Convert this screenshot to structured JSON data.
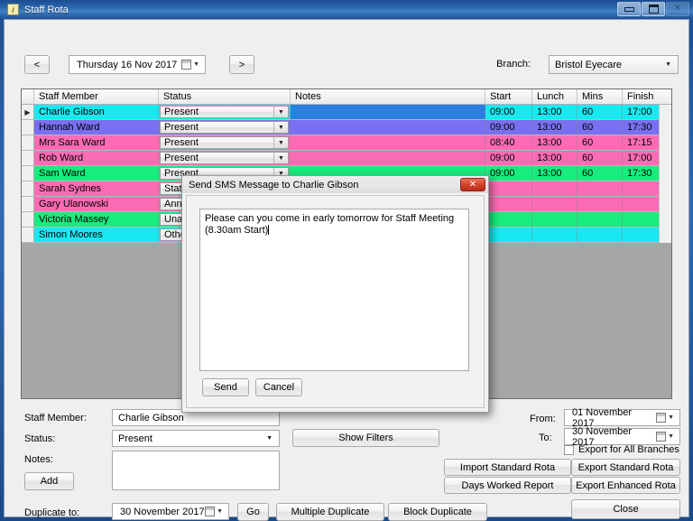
{
  "window": {
    "title": "Staff Rota",
    "icon": "info-icon",
    "minimize": "minimize-icon",
    "maximize": "maximize-icon",
    "close": "close-icon"
  },
  "toolbar": {
    "prev_label": "<",
    "next_label": ">",
    "date_value": "Thursday   16 Nov 2017",
    "branch_label": "Branch:",
    "branch_value": "Bristol Eyecare"
  },
  "grid": {
    "columns": [
      "Staff Member",
      "Status",
      "Notes",
      "Start",
      "Lunch",
      "Mins",
      "Finish"
    ],
    "rows": [
      {
        "selected": true,
        "name": "Charlie Gibson",
        "status": "Present",
        "notes": "",
        "start": "09:00",
        "lunch": "13:00",
        "mins": "60",
        "finish": "17:00",
        "color": "#16eaf0",
        "notes_color": "#2a7fe0"
      },
      {
        "selected": false,
        "name": "Hannah Ward",
        "status": "Present",
        "notes": "",
        "start": "09:00",
        "lunch": "13:00",
        "mins": "60",
        "finish": "17:30",
        "color": "#7a6ff0",
        "notes_color": "#7a6ff0"
      },
      {
        "selected": false,
        "name": "Mrs Sara Ward",
        "status": "Present",
        "notes": "",
        "start": "08:40",
        "lunch": "13:00",
        "mins": "60",
        "finish": "17:15",
        "color": "#fc6cb4",
        "notes_color": "#fc6cb4"
      },
      {
        "selected": false,
        "name": "Rob Ward",
        "status": "Present",
        "notes": "",
        "start": "09:00",
        "lunch": "13:00",
        "mins": "60",
        "finish": "17:00",
        "color": "#fc6cb4",
        "notes_color": "#fc6cb4"
      },
      {
        "selected": false,
        "name": "Sam Ward",
        "status": "Present",
        "notes": "",
        "start": "09:00",
        "lunch": "13:00",
        "mins": "60",
        "finish": "17:30",
        "color": "#18ec7e",
        "notes_color": "#18ec7e"
      },
      {
        "selected": false,
        "name": "Sarah Sydnes",
        "status": "Statutory holiday",
        "notes": "",
        "start": "",
        "lunch": "",
        "mins": "",
        "finish": "",
        "color": "#fc6cb4",
        "notes_color": "#fc6cb4"
      },
      {
        "selected": false,
        "name": "Gary Ulanowski",
        "status": "Annual holiday",
        "notes": "",
        "start": "",
        "lunch": "",
        "mins": "",
        "finish": "",
        "color": "#fc6cb4",
        "notes_color": "#fc6cb4"
      },
      {
        "selected": false,
        "name": "Victoria Massey",
        "status": "Unavailable",
        "notes": "",
        "start": "",
        "lunch": "",
        "mins": "",
        "finish": "",
        "color": "#18ec7e",
        "notes_color": "#18ec7e"
      },
      {
        "selected": false,
        "name": "Simon Moores",
        "status": "Other",
        "notes": "",
        "start": "",
        "lunch": "",
        "mins": "",
        "finish": "",
        "color": "#16eaf0",
        "notes_color": "#16eaf0"
      }
    ]
  },
  "form": {
    "staff_member_label": "Staff Member:",
    "staff_member_value": "Charlie Gibson",
    "status_label": "Status:",
    "status_value": "Present",
    "notes_label": "Notes:",
    "notes_value": "",
    "add_label": "Add",
    "duplicate_to_label": "Duplicate to:",
    "duplicate_to_value": "30 November 2017",
    "go_label": "Go",
    "multiple_duplicate_label": "Multiple Duplicate",
    "block_duplicate_label": "Block Duplicate",
    "show_filters_label": "Show Filters"
  },
  "export": {
    "from_label": "From:",
    "from_value": "01 November 2017",
    "to_label": "To:",
    "to_value": "30 November 2017",
    "all_branches_label": "Export for All Branches",
    "import_standard_rota": "Import Standard Rota",
    "days_worked_report": "Days Worked Report",
    "export_standard_rota": "Export Standard Rota",
    "export_enhanced_rota": "Export Enhanced Rota",
    "close_label": "Close"
  },
  "modal": {
    "title": "Send SMS Message to Charlie Gibson",
    "close_icon": "close-icon",
    "message": "Please can you come in early tomorrow for Staff Meeting (8.30am Start)",
    "send_label": "Send",
    "cancel_label": "Cancel"
  },
  "colors": {
    "title_bar": "#2d6cb4",
    "selection": "#2a7fe0",
    "modal_close": "#d4432a",
    "grid_background": "#a6a6a6"
  }
}
